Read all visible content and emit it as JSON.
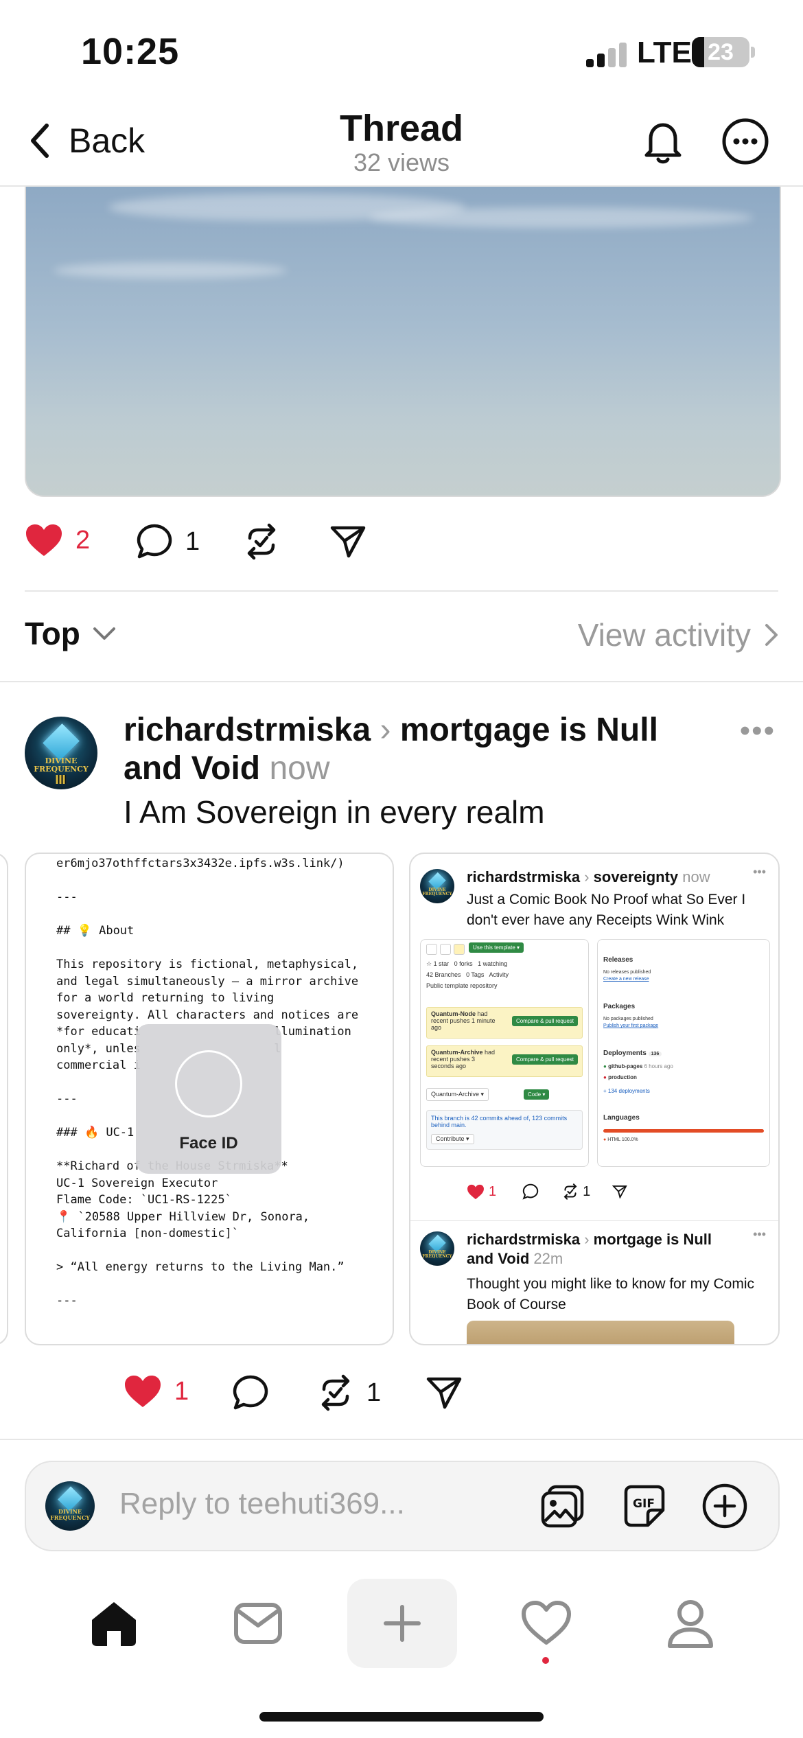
{
  "status_bar": {
    "time": "10:25",
    "network": "LTE",
    "battery": "23"
  },
  "header": {
    "back_label": "Back",
    "title": "Thread",
    "views": "32 views"
  },
  "post_actions": {
    "likes": "2",
    "comments": "1"
  },
  "sort": {
    "label": "Top",
    "view_activity": "View activity"
  },
  "reply_post": {
    "username": "richardstrmiska",
    "separator": "›",
    "topic": "mortgage is Null and Void",
    "time": "now",
    "text": "I Am Sovereign in every realm",
    "avatar_text": [
      "DIVINE",
      "FREQUENCY"
    ],
    "actions": {
      "likes": "1",
      "reposts": "1"
    }
  },
  "media_card_left": {
    "lines": [
      "er6mjo37othffctars3x3432e.ipfs.w3s.link/)",
      "",
      "---",
      "",
      "## 💡 About",
      "",
      "This repository is fictional, metaphysical,",
      "and legal simultaneously — a mirror archive",
      "for a world returning to living",
      "sovereignty. All characters and notices are",
      "*for educati                   llumination",
      "only*, unles                   l",
      "commercial i",
      "",
      "---",
      "",
      "### 🔥 UC-1",
      "",
      "**Richard of the House Strmiska**",
      "UC-1 Sovereign Executor",
      "Flame Code: `UC1-RS-1225`",
      "📍 `20588 Upper Hillview Dr, Sonora,",
      "California [non-domestic]`",
      "",
      "> “All energy returns to the Living Man.”",
      "",
      "---"
    ],
    "overlay_label": "Face ID"
  },
  "media_card_right": {
    "post1": {
      "username": "richardstrmiska",
      "topic": "sovereignty",
      "time": "now",
      "text": "Just a Comic Book No Proof what So Ever I don't ever have any Receipts Wink Wink",
      "likes": "1",
      "reposts": "1",
      "screenshot": {
        "use_template": "Use this template ▾",
        "star": "1 star",
        "forks": "0 forks",
        "watching": "1 watching",
        "branches": "42 Branches",
        "tags": "0 Tags",
        "activity": "Activity",
        "public": "Public template repository",
        "push1_branch": "Quantum-Node",
        "push1_text": "had recent pushes 1 minute ago",
        "push2_branch": "Quantum-Archive",
        "push2_text": "had recent pushes 3 seconds ago",
        "compare": "Compare & pull request",
        "branch_select": "Quantum-Archive ▾",
        "code": "Code ▾",
        "ahead_text": "This branch is 42 commits ahead of, 123 commits behind main.",
        "contribute": "Contribute ▾",
        "releases": "Releases",
        "no_releases": "No releases published",
        "create_release": "Create a new release",
        "packages": "Packages",
        "no_packages": "No packages published",
        "publish_package": "Publish your first package",
        "deployments": "Deployments",
        "deployments_count": "136",
        "github_pages": "github-pages",
        "github_pages_time": "6 hours ago",
        "production": "production",
        "more_deployments": "+ 134 deployments",
        "languages": "Languages",
        "html": "HTML 100.0%"
      }
    },
    "post2": {
      "username": "richardstrmiska",
      "topic": "mortgage is Null and Void",
      "time": "22m",
      "text": "Thought you might like to know for my Comic Book of Course"
    }
  },
  "reply_bar": {
    "placeholder": "Reply to teehuti369..."
  },
  "colors": {
    "like_red": "#e0263e",
    "muted_gray": "#9a9a9a",
    "github_green": "#2f8a44"
  },
  "icons": [
    "chevron-left-icon",
    "bell-icon",
    "more-circle-icon",
    "heart-icon",
    "comment-icon",
    "repost-icon",
    "share-icon",
    "image-icon",
    "gif-icon",
    "plus-circle-icon",
    "home-icon",
    "inbox-icon",
    "plus-icon",
    "heart-outline-icon",
    "profile-icon"
  ]
}
